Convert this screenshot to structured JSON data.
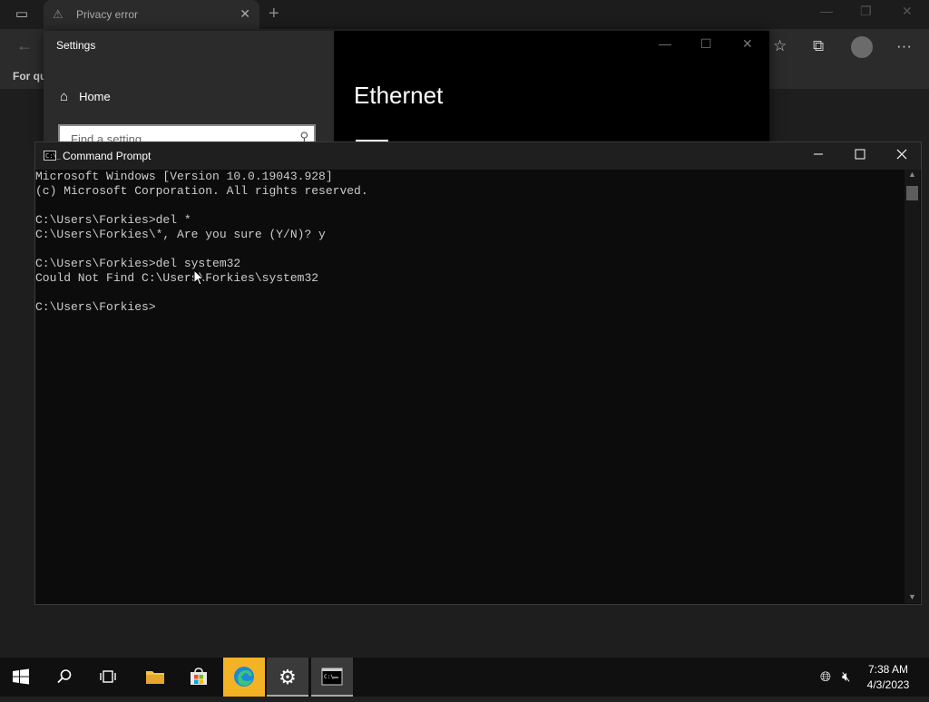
{
  "browser": {
    "tab_title": "Privacy error",
    "new_tab_glyph": "+",
    "close_glyph": "✕",
    "favorites_text": "For qu"
  },
  "settings": {
    "window_title": "Settings",
    "home_label": "Home",
    "search_placeholder": "Find a setting",
    "page_heading": "Ethernet"
  },
  "cmd": {
    "window_title": "Command Prompt",
    "icon_text": "C:\\_",
    "lines": [
      "Microsoft Windows [Version 10.0.19043.928]",
      "(c) Microsoft Corporation. All rights reserved.",
      "",
      "C:\\Users\\Forkies>del *",
      "C:\\Users\\Forkies\\*, Are you sure (Y/N)? y",
      "",
      "C:\\Users\\Forkies>del system32",
      "Could Not Find C:\\Users\\Forkies\\system32",
      "",
      "C:\\Users\\Forkies>"
    ]
  },
  "taskbar": {
    "time": "7:38 AM",
    "date": "4/3/2023",
    "items": [
      "start-button",
      "search-button",
      "task-view-button",
      "file-explorer-button",
      "store-button",
      "edge-button",
      "settings-button",
      "cmd-button"
    ]
  },
  "colors": {
    "console_bg": "#0c0c0c",
    "console_text": "#cccccc",
    "taskbar_bg": "#101010",
    "edge_highlight": "#f4b324"
  }
}
